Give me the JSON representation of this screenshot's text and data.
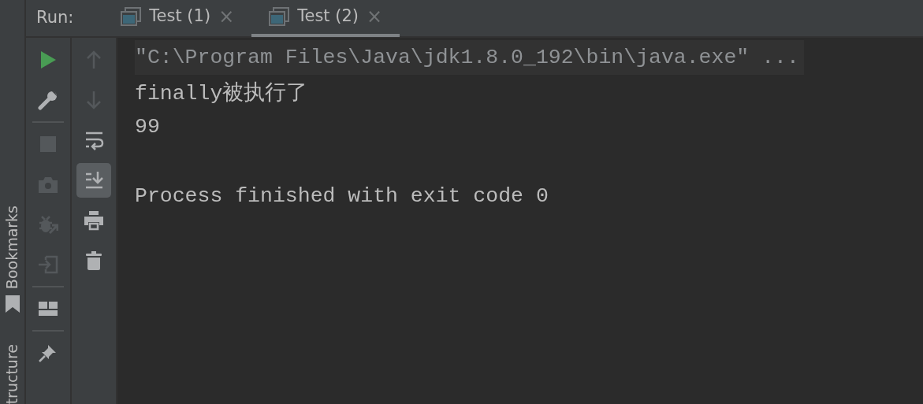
{
  "run_label": "Run:",
  "tabs": [
    {
      "label": "Test (1)",
      "close": "×",
      "selected": false
    },
    {
      "label": "Test (2)",
      "close": "×",
      "selected": true
    }
  ],
  "side_tabs": [
    "Bookmarks",
    "tructure"
  ],
  "toolbar_left": [
    {
      "kind": "button",
      "disabled": false
    },
    {
      "kind": "button",
      "disabled": false
    },
    {
      "kind": "separator"
    },
    {
      "kind": "button",
      "disabled": true
    },
    {
      "kind": "button",
      "disabled": true
    },
    {
      "kind": "button",
      "disabled": true
    },
    {
      "kind": "button",
      "disabled": true
    },
    {
      "kind": "separator"
    },
    {
      "kind": "button",
      "disabled": false
    },
    {
      "kind": "separator"
    },
    {
      "kind": "button",
      "disabled": false
    }
  ],
  "toolbar_right": [
    {
      "kind": "button",
      "disabled": true,
      "selected": false
    },
    {
      "kind": "button",
      "disabled": true,
      "selected": false
    },
    {
      "kind": "button",
      "disabled": false,
      "selected": false
    },
    {
      "kind": "button",
      "disabled": false,
      "selected": true
    },
    {
      "kind": "button",
      "disabled": false,
      "selected": false
    },
    {
      "kind": "button",
      "disabled": false,
      "selected": false
    }
  ],
  "console": [
    {
      "kind": "command",
      "text": "\"C:\\Program Files\\Java\\jdk1.8.0_192\\bin\\java.exe\" ..."
    },
    {
      "kind": "output",
      "text": "finally被执行了"
    },
    {
      "kind": "output",
      "text": "99"
    },
    {
      "kind": "blank"
    },
    {
      "kind": "system",
      "text": "Process finished with exit code 0"
    }
  ]
}
